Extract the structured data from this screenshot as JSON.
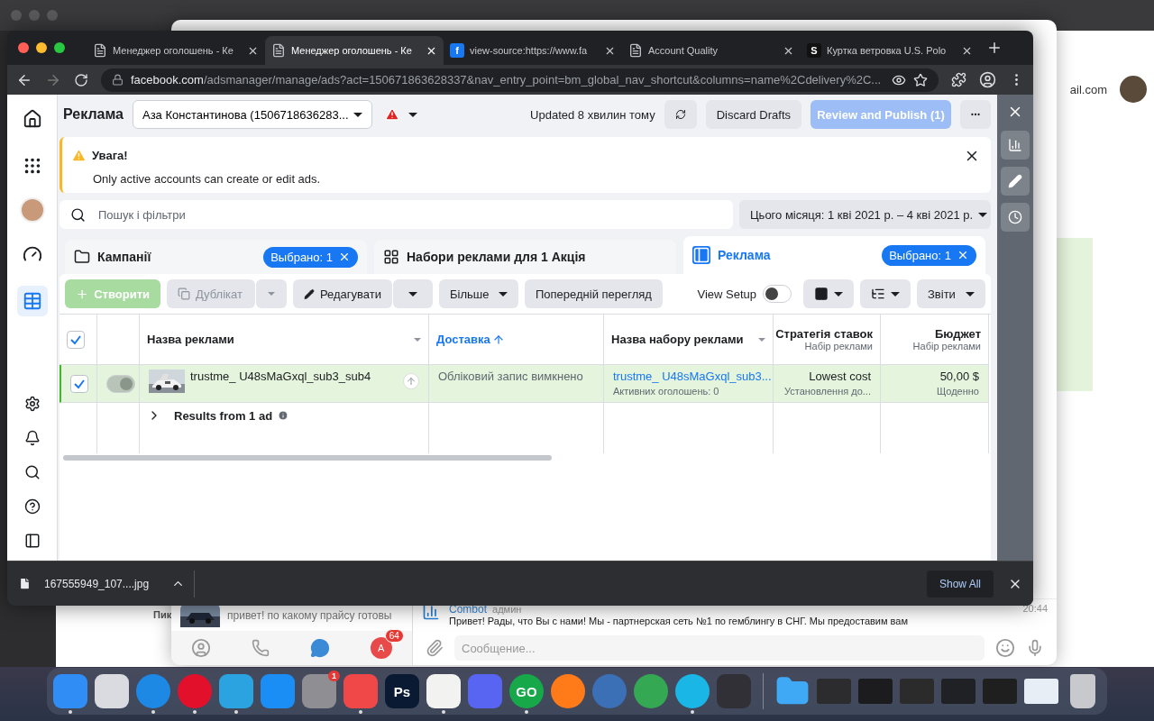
{
  "safari": {
    "page_fragment": "ail.com",
    "list_name": "Пик"
  },
  "chrome": {
    "tabs": [
      {
        "favicon": {
          "kind": "page"
        },
        "title": "Менеджер оголошень - Ке",
        "selected": false
      },
      {
        "favicon": {
          "kind": "page"
        },
        "title": "Менеджер оголошень - Ке",
        "selected": true
      },
      {
        "favicon": {
          "kind": "letter",
          "text": "f",
          "color": "#1877f2"
        },
        "title": "view-source:https://www.fa",
        "selected": false
      },
      {
        "favicon": {
          "kind": "page"
        },
        "title": "Account Quality",
        "selected": false
      },
      {
        "favicon": {
          "kind": "letter",
          "text": "S",
          "color": "#111111"
        },
        "title": "Куртка ветровка U.S. Polo",
        "selected": false
      }
    ],
    "address": {
      "host": "facebook.com",
      "path": "/adsmanager/manage/ads?act=150671863628337&nav_entry_point=bm_global_nav_shortcut&columns=name%2Cdelivery%2C..."
    }
  },
  "ads_manager": {
    "title": "Реклама",
    "account": "Аза Константинова (1506718636283...",
    "updated": "Updated 8 хвилин тому",
    "discard": "Discard Drafts",
    "publish": {
      "label": "Review and Publish (1)",
      "disabled": true
    },
    "alert": {
      "title": "Увага!",
      "message": "Only active accounts can create or edit ads."
    },
    "search": {
      "placeholder": "Пошук і фільтри"
    },
    "date_range": "Цього місяця: 1 кві 2021 р. – 4 кві 2021 р.",
    "level_tabs": [
      {
        "kind": "campaign",
        "label": "Кампанії",
        "chip": "Выбрано: 1",
        "selected": false
      },
      {
        "kind": "adset",
        "label": "Набори реклами для 1 Акція",
        "selected": false
      },
      {
        "kind": "ad",
        "label": "Реклама",
        "chip": "Выбрано: 1",
        "selected": true
      }
    ],
    "toolbar": {
      "create": {
        "label": "Створити",
        "disabled": true
      },
      "duplicate": {
        "label": "Дублікат",
        "disabled": true
      },
      "edit": "Редагувати",
      "more": "Більше",
      "preview": "Попередній перегляд",
      "view_setup": {
        "label": "View Setup",
        "on": false
      },
      "reports": "Звіти"
    },
    "table": {
      "all_checked": true,
      "columns": [
        {
          "label": "Назва реклами",
          "sorted": false,
          "menu": true
        },
        {
          "label": "Доставка",
          "sorted": true,
          "menu": false
        },
        {
          "label": "Назва набору реклами",
          "sorted": false,
          "menu": true
        },
        {
          "label": "Стратегія ставок",
          "sublabel": "Набір реклами",
          "sorted": false,
          "menu": false
        },
        {
          "label": "Бюджет",
          "sublabel": "Набір реклами",
          "sorted": false,
          "menu": false
        }
      ],
      "rows": [
        {
          "selected": true,
          "on": true,
          "name": "trustme_ U48sMaGxql_sub3_sub4",
          "delivery": "Обліковий запис вимкнено",
          "ad_set": "trustme_ U48sMaGxql_sub3...",
          "ad_set_note": "Активних оголошень: 0",
          "bid_strategy": "Lowest cost",
          "bid_note": "Установлення до...",
          "budget": "50,00 $",
          "budget_note": "Щоденно"
        }
      ],
      "summary": "Results from 1 ad"
    }
  },
  "download_bar": {
    "file": "167555949_107....jpg",
    "show_all": "Show All"
  },
  "telegram": {
    "chat_preview": "привет! по какому прайсу готовы",
    "message": {
      "author": "Combot",
      "role": "админ",
      "text": "Привет! Рады, что Вы с нами! Мы - партнерская сеть №1 по гемблингу в СНГ. Мы предоставим вам",
      "time": "20:44"
    },
    "avatar_letter": "A",
    "unread": "64",
    "composer": {
      "placeholder": "Сообщение..."
    }
  },
  "dock": [
    {
      "kind": "app",
      "color": "#2f8df5",
      "running": true
    },
    {
      "kind": "app",
      "color": "#d9dbe0",
      "running": false
    },
    {
      "kind": "ring",
      "color": "#1e88e5",
      "running": true
    },
    {
      "kind": "ring",
      "color": "#e3102b",
      "running": true
    },
    {
      "kind": "app",
      "color": "#2aa3e0",
      "running": true
    },
    {
      "kind": "app",
      "color": "#1b8ef5",
      "running": false
    },
    {
      "kind": "app",
      "color": "#8e8e93",
      "running": false,
      "badge": "1"
    },
    {
      "kind": "app",
      "color": "#f04848",
      "running": true
    },
    {
      "kind": "app",
      "color": "#0a1a33",
      "running": false,
      "glyph": "Ps"
    },
    {
      "kind": "app",
      "color": "#f2f2f0",
      "running": true
    },
    {
      "kind": "app",
      "color": "#5865f2",
      "running": false
    },
    {
      "kind": "ring",
      "color": "#17a84a",
      "running": true,
      "glyph": "GO"
    },
    {
      "kind": "ring",
      "color": "#ff7a18",
      "running": false
    },
    {
      "kind": "ring",
      "color": "#3b6fb6",
      "running": false
    },
    {
      "kind": "ring",
      "color": "#34a853",
      "running": false
    },
    {
      "kind": "ring",
      "color": "#19b6e6",
      "running": true
    },
    {
      "kind": "app",
      "color": "#303036",
      "running": false
    },
    {
      "kind": "divider"
    },
    {
      "kind": "folder",
      "color": "#3fa9f5",
      "running": false
    },
    {
      "kind": "window",
      "color": "#2c2c2e",
      "running": false
    },
    {
      "kind": "window",
      "color": "#1c1c1e",
      "running": false
    },
    {
      "kind": "window",
      "color": "#2b2b2b",
      "running": false
    },
    {
      "kind": "window",
      "color": "#202124",
      "running": false
    },
    {
      "kind": "window",
      "color": "#1f1f1f",
      "running": false
    },
    {
      "kind": "window",
      "color": "#e8eef5",
      "running": false
    },
    {
      "kind": "trash",
      "color": "#c7c9cc",
      "running": false
    }
  ]
}
